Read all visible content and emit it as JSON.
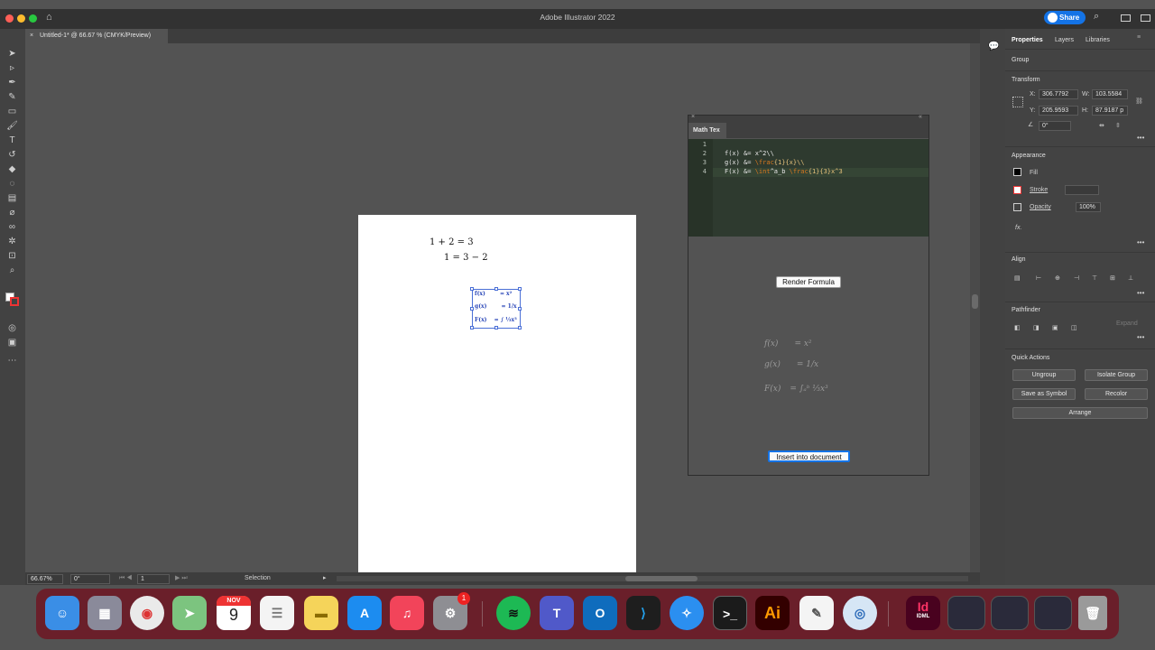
{
  "window": {
    "title": "Adobe Illustrator 2022",
    "share_label": "Share"
  },
  "document_tab": {
    "close": "×",
    "label": "Untitled-1* @ 66.67 % (CMYK/Preview)"
  },
  "artboard": {
    "eq1": "1 + 2 = 3",
    "eq2": "1 = 3 − 2",
    "selected_group": {
      "rows": [
        {
          "lhs": "f(x)",
          "rhs": "= x²"
        },
        {
          "lhs": "g(x)",
          "rhs": "= 1/x"
        },
        {
          "lhs": "F(x)",
          "rhs": "= ∫ ⅓x³"
        }
      ]
    }
  },
  "status": {
    "zoom": "66.67%",
    "rotation": "0°",
    "page": "1",
    "tool": "Selection"
  },
  "math_tex": {
    "title": "Math Tex",
    "line_numbers": [
      "1",
      "2",
      "3",
      "4"
    ],
    "code": {
      "l2_a": "f(x) &= x^2\\\\",
      "l3_a": "g(x) &= ",
      "l3_kw": "\\frac",
      "l3_b": "{1}{x}\\\\",
      "l4_a": "F(x) &= ",
      "l4_kw1": "\\int",
      "l4_b": "^a_b ",
      "l4_kw2": "\\frac",
      "l4_c": "{1}{3}x^3"
    },
    "render_button": "Render Formula",
    "insert_button": "Insert into document",
    "preview": [
      {
        "lhs": "f(x)",
        "rhs": "= x²"
      },
      {
        "lhs": "g(x)",
        "rhs": "= 1/x"
      },
      {
        "lhs": "F(x)",
        "rhs": "= ∫ₐᵇ ⅓x³"
      }
    ]
  },
  "properties": {
    "tabs": [
      "Properties",
      "Layers",
      "Libraries"
    ],
    "selection_type": "Group",
    "transform": {
      "title": "Transform",
      "x_label": "X:",
      "x": "306.7792",
      "y_label": "Y:",
      "y": "205.9593",
      "w_label": "W:",
      "w": "103.5584",
      "h_label": "H:",
      "h": "87.9187 p",
      "angle": "0°"
    },
    "appearance": {
      "title": "Appearance",
      "fill": "Fill",
      "stroke": "Stroke",
      "opacity_label": "Opacity",
      "opacity": "100%",
      "fx": "fx."
    },
    "align_title": "Align",
    "pathfinder": {
      "title": "Pathfinder",
      "expand": "Expand"
    },
    "quick_actions": {
      "title": "Quick Actions",
      "ungroup": "Ungroup",
      "isolate": "Isolate Group",
      "symbol": "Save as Symbol",
      "recolor": "Recolor",
      "arrange": "Arrange"
    }
  },
  "dock": {
    "calendar_month": "NOV",
    "calendar_day": "9",
    "settings_badge": "1",
    "ai_label": "Ai",
    "id_label": "Id",
    "idml_label": "IDML"
  },
  "colors": {
    "accent": "#1473e6",
    "selection": "#4a6fd6",
    "editor_bg": "#2e3a2f",
    "keyword": "#d9781e"
  }
}
